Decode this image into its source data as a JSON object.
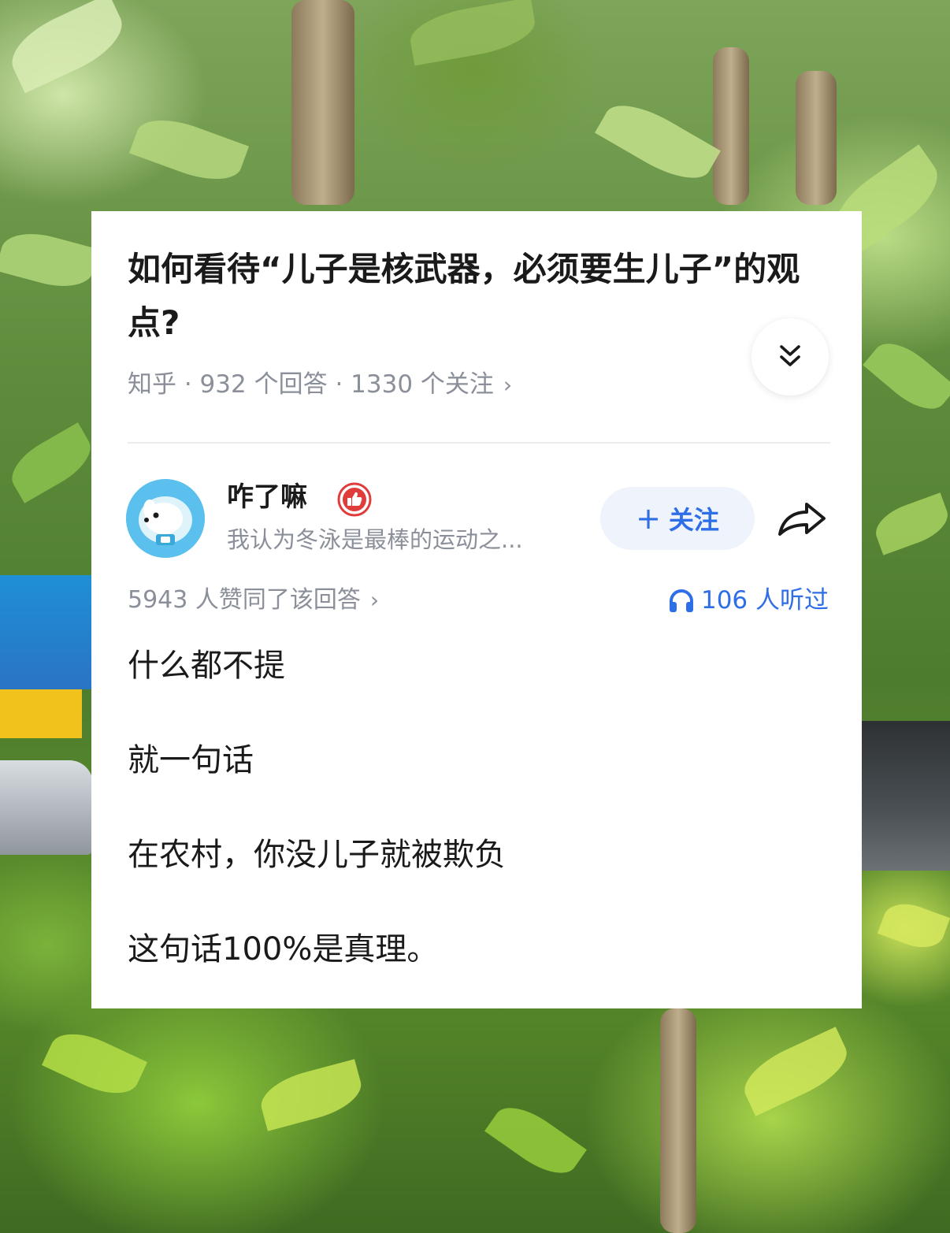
{
  "question": {
    "title": "如何看待“儿子是核武器，必须要生儿子”的观点?",
    "meta": "知乎 · 932 个回答 · 1330 个关注",
    "meta_chevron": "›"
  },
  "author": {
    "name": "咋了嘛",
    "bio": "我认为冬泳是最棒的运动之...",
    "follow_label": "关注",
    "follow_plus": "+"
  },
  "stats": {
    "agree_text": "5943 人赞同了该回答",
    "agree_chevron": "›",
    "listen_text": "106 人听过"
  },
  "answer": {
    "paragraphs": [
      "什么都不提",
      "就一句话",
      "在农村，你没儿子就被欺负",
      "这句话100%是真理。"
    ]
  },
  "colors": {
    "accent": "#2e6ee6",
    "meta_gray": "#8a8f99",
    "text": "#1a1a1a",
    "badge_red": "#e03c3c"
  },
  "icons": {
    "expand": "double-chevron-down-icon",
    "share": "share-arrow-icon",
    "listen": "headphones-icon",
    "badge": "thumbs-up-badge-icon"
  }
}
